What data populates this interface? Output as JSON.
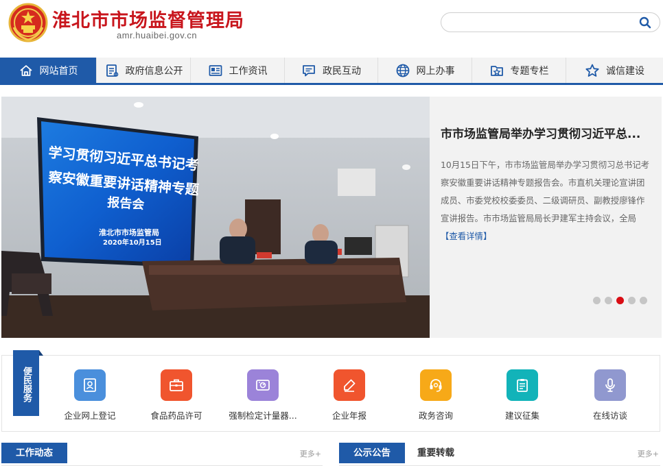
{
  "header": {
    "title": "淮北市市场监督管理局",
    "domain": "amr.huaibei.gov.cn",
    "search_placeholder": ""
  },
  "nav": {
    "items": [
      {
        "label": "网站首页",
        "icon": "home-icon",
        "active": true
      },
      {
        "label": "政府信息公开",
        "icon": "document-list-icon",
        "active": false
      },
      {
        "label": "工作资讯",
        "icon": "newspaper-icon",
        "active": false
      },
      {
        "label": "政民互动",
        "icon": "chat-icon",
        "active": false
      },
      {
        "label": "网上办事",
        "icon": "globe-icon",
        "active": false
      },
      {
        "label": "专题专栏",
        "icon": "star-folder-icon",
        "active": false
      },
      {
        "label": "诚信建设",
        "icon": "star-icon",
        "active": false
      }
    ]
  },
  "banner": {
    "screen_line1": "学习贯彻习近平总书记考",
    "screen_line2": "察安徽重要讲话精神专题",
    "screen_line3": "报告会",
    "screen_org": "淮北市市场监管局",
    "screen_date": "2020年10月15日",
    "title": "市市场监管局举办学习贯彻习近平总...",
    "description": "10月15日下午，市市场监管局举办学习贯彻习总书记考察安徽重要讲话精神专题报告会。市直机关理论宣讲团成员、市委党校校委委员、二级调研员、副教授廖锋作宣讲报告。市市场监管局局长尹建军主持会议，全局",
    "more_label": "【查看详情】",
    "active_dot": 2,
    "dot_count": 5
  },
  "services": {
    "tag": "便民服务",
    "items": [
      {
        "label": "企业网上登记",
        "icon": "id-card-icon",
        "color": "#4a8fdc"
      },
      {
        "label": "食品药品许可",
        "icon": "briefcase-icon",
        "color": "#f0552e"
      },
      {
        "label": "强制检定计量器...",
        "icon": "gauge-icon",
        "color": "#9b83d9"
      },
      {
        "label": "企业年报",
        "icon": "edit-icon",
        "color": "#f0552e"
      },
      {
        "label": "政务咨询",
        "icon": "headset-icon",
        "color": "#f7a918"
      },
      {
        "label": "建议征集",
        "icon": "clipboard-icon",
        "color": "#12b3b9"
      },
      {
        "label": "在线访谈",
        "icon": "microphone-icon",
        "color": "#9098cf"
      }
    ]
  },
  "sections": {
    "left": {
      "tab": "工作动态",
      "more": "更多+"
    },
    "right": {
      "tab_active": "公示公告",
      "tab_other": "重要转载",
      "more": "更多+"
    }
  },
  "colors": {
    "brand_red": "#c8161d",
    "nav_blue": "#1f5aa8",
    "dot_active": "#d90d14"
  }
}
